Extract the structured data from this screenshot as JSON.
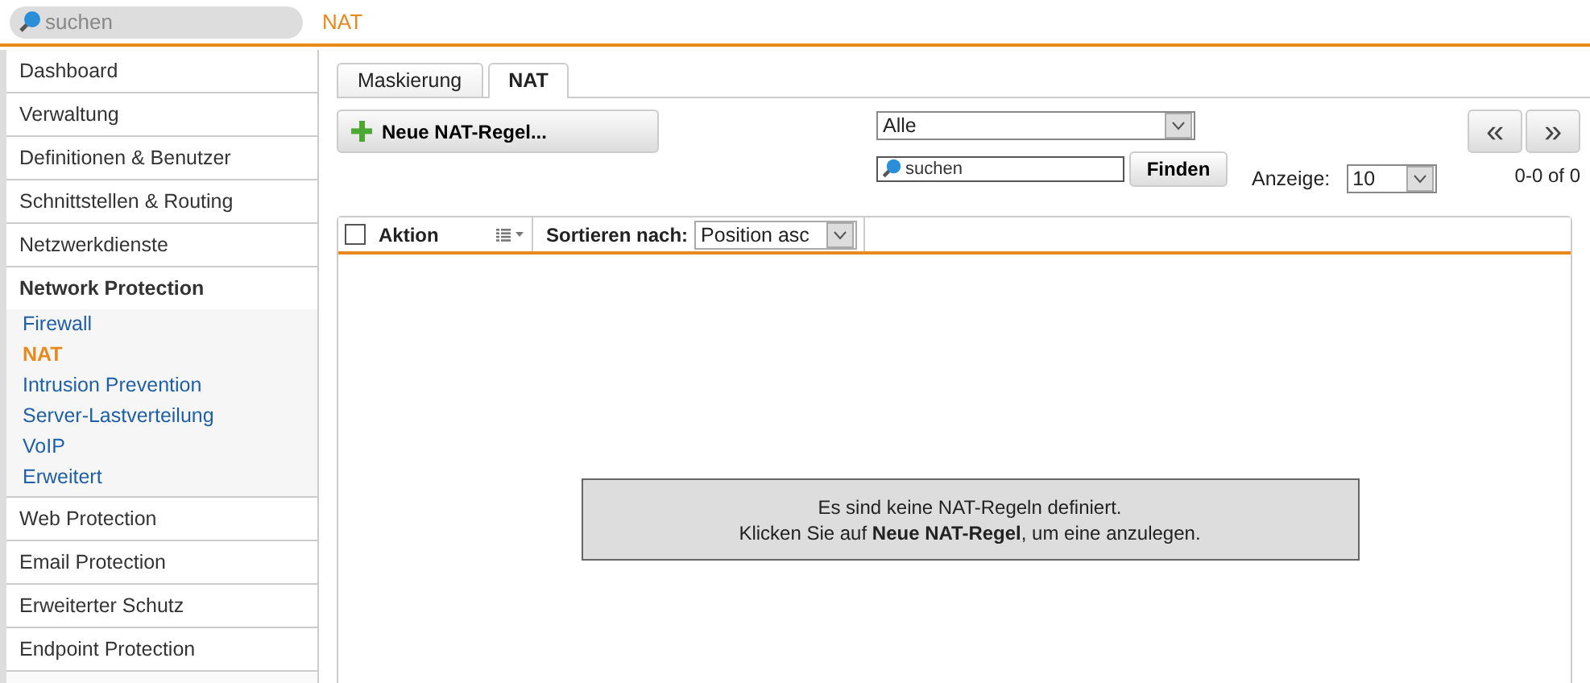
{
  "search": {
    "placeholder": "suchen"
  },
  "breadcrumb": "NAT",
  "sidebar": {
    "items": [
      {
        "label": "Dashboard",
        "expanded": false
      },
      {
        "label": "Verwaltung",
        "expanded": false
      },
      {
        "label": "Definitionen & Benutzer",
        "expanded": false
      },
      {
        "label": "Schnittstellen & Routing",
        "expanded": false
      },
      {
        "label": "Netzwerkdienste",
        "expanded": false
      },
      {
        "label": "Network Protection",
        "expanded": true,
        "children": [
          {
            "label": "Firewall",
            "selected": false
          },
          {
            "label": "NAT",
            "selected": true
          },
          {
            "label": "Intrusion Prevention",
            "selected": false
          },
          {
            "label": "Server-Lastverteilung",
            "selected": false
          },
          {
            "label": "VoIP",
            "selected": false
          },
          {
            "label": "Erweitert",
            "selected": false
          }
        ]
      },
      {
        "label": "Web Protection",
        "expanded": false
      },
      {
        "label": "Email Protection",
        "expanded": false
      },
      {
        "label": "Erweiterter Schutz",
        "expanded": false
      },
      {
        "label": "Endpoint Protection",
        "expanded": false
      }
    ]
  },
  "tabs": [
    {
      "label": "Maskierung",
      "selected": false
    },
    {
      "label": "NAT",
      "selected": true
    }
  ],
  "new_button": "Neue NAT-Regel...",
  "filter": {
    "value": "Alle"
  },
  "list_search": {
    "placeholder": "suchen"
  },
  "find_button": "Finden",
  "display": {
    "label": "Anzeige:",
    "value": "10"
  },
  "pager": {
    "prev": "«",
    "next": "»",
    "range": "0-0 of 0"
  },
  "table": {
    "select_all_checked": false,
    "action_label": "Aktion",
    "sort_label": "Sortieren nach:",
    "sort_value": "Position asc"
  },
  "empty_message": [
    "Es sind keine NAT-Regeln definiert.",
    "Klicken Sie auf **Neue NAT-Regel**, um eine anzulegen."
  ]
}
